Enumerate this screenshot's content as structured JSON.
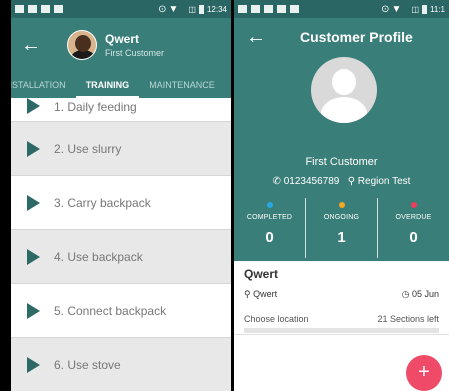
{
  "left": {
    "status": {
      "time": "12:34",
      "mid_icons": "⊙▼",
      "right_icons": "◫"
    },
    "header": {
      "back": "←",
      "title": "Qwert",
      "subtitle": "First Customer"
    },
    "tabs": [
      {
        "label": "INSTALLATION",
        "active": false
      },
      {
        "label": "TRAINING",
        "active": true
      },
      {
        "label": "MAINTENANCE",
        "active": false
      }
    ],
    "items": [
      {
        "label": "1. Daily feeding"
      },
      {
        "label": "2. Use slurry"
      },
      {
        "label": "3. Carry backpack"
      },
      {
        "label": "4. Use backpack"
      },
      {
        "label": "5. Connect backpack"
      },
      {
        "label": "6. Use stove"
      }
    ]
  },
  "right": {
    "status": {
      "time": "11:1",
      "mid_icons": "⊙▼",
      "right_icons": "◫"
    },
    "header": {
      "back": "←",
      "title": "Customer Profile"
    },
    "profile": {
      "name": "First Customer",
      "phone_icon": "phone-icon",
      "phone": "0123456789",
      "location_icon": "location-pin-icon",
      "region": "Region Test"
    },
    "stats": [
      {
        "label": "COMPLETED",
        "value": "0",
        "color": "#29a9e1"
      },
      {
        "label": "ONGOING",
        "value": "1",
        "color": "#f5a623"
      },
      {
        "label": "OVERDUE",
        "value": "0",
        "color": "#ef3b5c"
      }
    ],
    "card": {
      "name": "Qwert",
      "location": "Qwert",
      "date": "05 Jun",
      "choose_location": "Choose location",
      "sections_left": "21 Sections left"
    },
    "fab_label": "+"
  },
  "colors": {
    "teal": "#3a7e79",
    "teal_dark": "#2a6663",
    "accent": "#ef4b68"
  }
}
